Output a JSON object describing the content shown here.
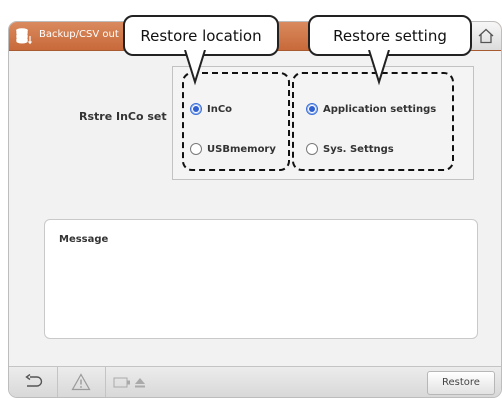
{
  "titlebar": {
    "title": "Backup/CSV out",
    "app_icon": "database-sort-icon",
    "home_icon": "home-icon"
  },
  "callouts": {
    "restore_location": "Restore location",
    "restore_setting": "Restore setting"
  },
  "form": {
    "row_label": "Rstre InCo set",
    "location_options": [
      {
        "label": "InCo",
        "selected": true
      },
      {
        "label": "USBmemory",
        "selected": false
      }
    ],
    "setting_options": [
      {
        "label": "Application settings",
        "selected": true
      },
      {
        "label": "Sys. Settngs",
        "selected": false
      }
    ]
  },
  "message": {
    "label": "Message"
  },
  "bottombar": {
    "back_icon": "back-arrow-icon",
    "warning_icon": "warning-icon",
    "eject_icon": "eject-icon",
    "restore_label": "Restore"
  },
  "colors": {
    "titlebar": "#c8693a",
    "radio_selected": "#2f5fd0"
  }
}
